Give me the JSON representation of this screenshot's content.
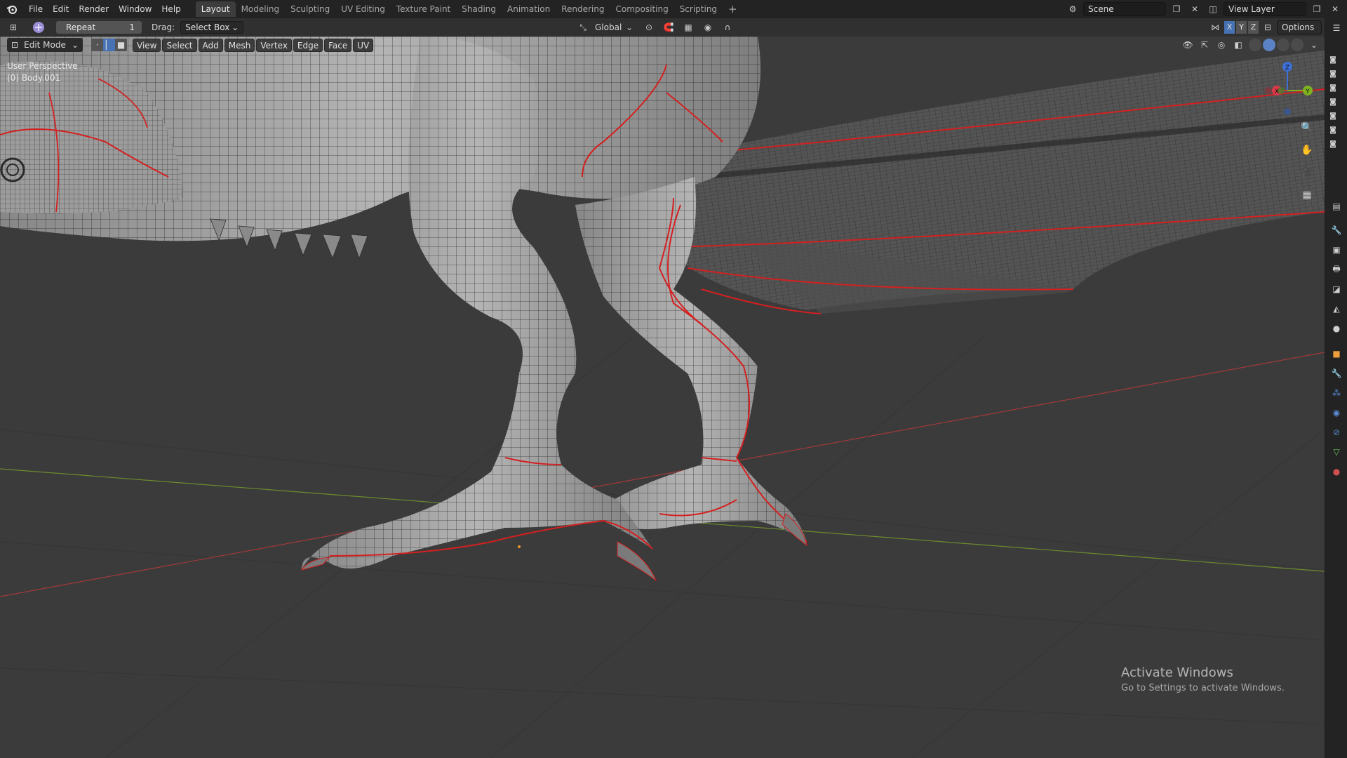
{
  "menu": [
    "File",
    "Edit",
    "Render",
    "Window",
    "Help"
  ],
  "workspaces": [
    {
      "label": "Layout",
      "active": true
    },
    {
      "label": "Modeling"
    },
    {
      "label": "Sculpting"
    },
    {
      "label": "UV Editing"
    },
    {
      "label": "Texture Paint"
    },
    {
      "label": "Shading"
    },
    {
      "label": "Animation"
    },
    {
      "label": "Rendering"
    },
    {
      "label": "Compositing"
    },
    {
      "label": "Scripting"
    }
  ],
  "add_workspace": "+",
  "scene": {
    "label": "Scene"
  },
  "view_layer": {
    "label": "View Layer"
  },
  "tool_settings": {
    "repeat_label": "Repeat",
    "repeat_value": "1",
    "drag_label": "Drag:",
    "drag_value": "Select Box",
    "transform_orientation": "Global",
    "options_label": "Options",
    "mirror_axes": [
      "X",
      "Y",
      "Z"
    ]
  },
  "viewport": {
    "mode": "Edit Mode",
    "menus": [
      "View",
      "Select",
      "Add",
      "Mesh",
      "Vertex",
      "Edge",
      "Face",
      "UV"
    ],
    "perspective": "User Perspective",
    "object_name": "(0) Body.001",
    "gizmo_axes": {
      "x": "X",
      "y": "Y",
      "z": "Z"
    }
  },
  "watermark": {
    "title": "Activate Windows",
    "subtitle": "Go to Settings to activate Windows."
  },
  "colors": {
    "accent_blue": "#4772b3",
    "seam_red": "#d42020",
    "grid_green": "#6e8b2e",
    "grid_red": "#a33a3a",
    "mesh_gray": "#b9b9b9"
  }
}
